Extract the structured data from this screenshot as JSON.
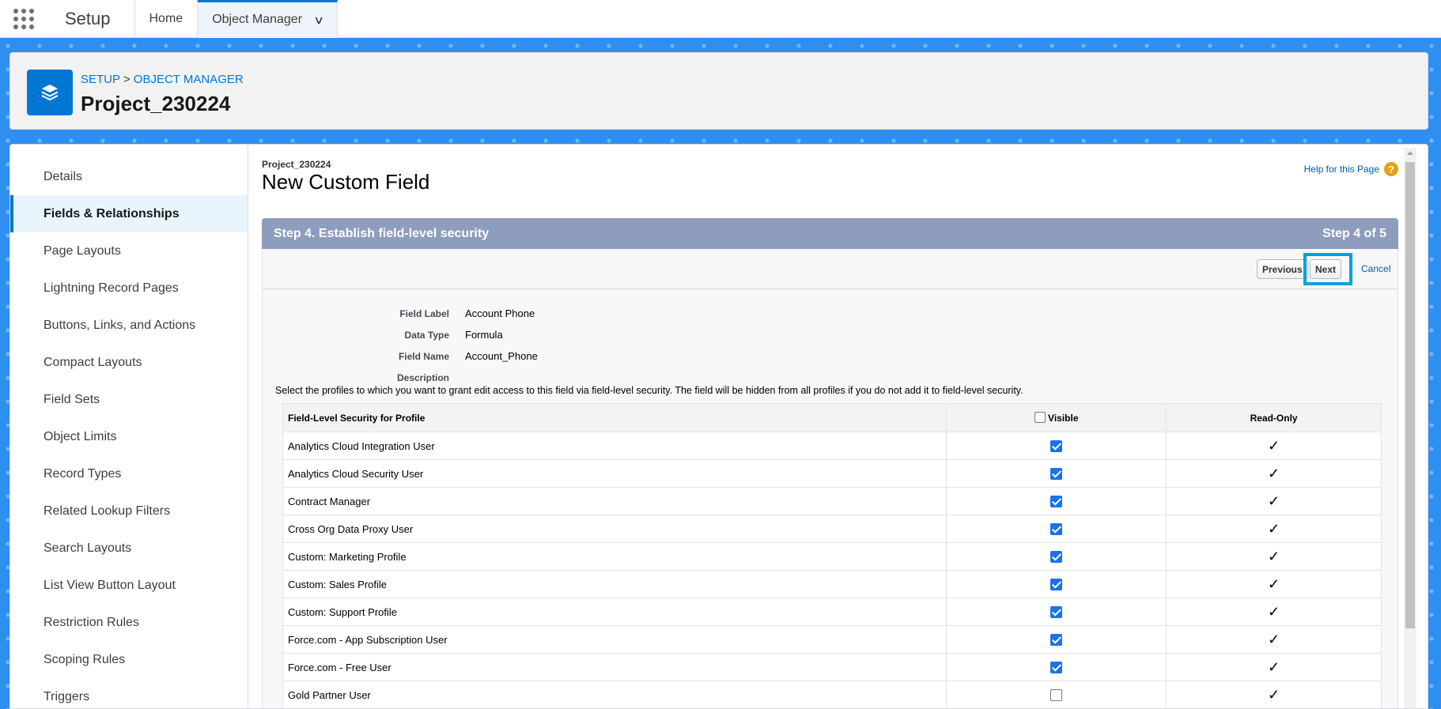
{
  "topnav": {
    "app_name": "Setup",
    "tabs": [
      {
        "label": "Home"
      },
      {
        "label": "Object Manager"
      }
    ]
  },
  "header": {
    "breadcrumb": [
      "SETUP",
      "OBJECT MANAGER"
    ],
    "breadcrumb_sep": ">",
    "title": "Project_230224"
  },
  "sidebar": {
    "items": [
      {
        "label": "Details"
      },
      {
        "label": "Fields & Relationships"
      },
      {
        "label": "Page Layouts"
      },
      {
        "label": "Lightning Record Pages"
      },
      {
        "label": "Buttons, Links, and Actions"
      },
      {
        "label": "Compact Layouts"
      },
      {
        "label": "Field Sets"
      },
      {
        "label": "Object Limits"
      },
      {
        "label": "Record Types"
      },
      {
        "label": "Related Lookup Filters"
      },
      {
        "label": "Search Layouts"
      },
      {
        "label": "List View Button Layout"
      },
      {
        "label": "Restriction Rules"
      },
      {
        "label": "Scoping Rules"
      },
      {
        "label": "Triggers"
      }
    ],
    "active_index": 1
  },
  "content": {
    "object_name": "Project_230224",
    "title": "New Custom Field",
    "help_link": "Help for this Page",
    "help_icon": "?",
    "step_title": "Step 4. Establish field-level security",
    "step_count": "Step 4 of 5",
    "buttons": {
      "previous": "Previous",
      "next": "Next",
      "cancel": "Cancel"
    },
    "field_info": [
      {
        "label": "Field Label",
        "value": "Account Phone"
      },
      {
        "label": "Data Type",
        "value": "Formula"
      },
      {
        "label": "Field Name",
        "value": "Account_Phone"
      },
      {
        "label": "Description",
        "value": ""
      }
    ],
    "instructions": "Select the profiles to which you want to grant edit access to this field via field-level security. The field will be hidden from all profiles if you do not add it to field-level security.",
    "fls_table": {
      "headers": {
        "profile": "Field-Level Security for Profile",
        "visible": "Visible",
        "read_only": "Read-Only"
      },
      "rows": [
        {
          "profile": "Analytics Cloud Integration User",
          "visible": true,
          "read_only": true
        },
        {
          "profile": "Analytics Cloud Security User",
          "visible": true,
          "read_only": true
        },
        {
          "profile": "Contract Manager",
          "visible": true,
          "read_only": true
        },
        {
          "profile": "Cross Org Data Proxy User",
          "visible": true,
          "read_only": true
        },
        {
          "profile": "Custom: Marketing Profile",
          "visible": true,
          "read_only": true
        },
        {
          "profile": "Custom: Sales Profile",
          "visible": true,
          "read_only": true
        },
        {
          "profile": "Custom: Support Profile",
          "visible": true,
          "read_only": true
        },
        {
          "profile": "Force.com - App Subscription User",
          "visible": true,
          "read_only": true
        },
        {
          "profile": "Force.com - Free User",
          "visible": true,
          "read_only": true
        },
        {
          "profile": "Gold Partner User",
          "visible": false,
          "read_only": true
        }
      ]
    }
  },
  "colors": {
    "brand": "#0176d3",
    "step_bar": "#8e9dbe",
    "highlight": "#00a1e0"
  }
}
